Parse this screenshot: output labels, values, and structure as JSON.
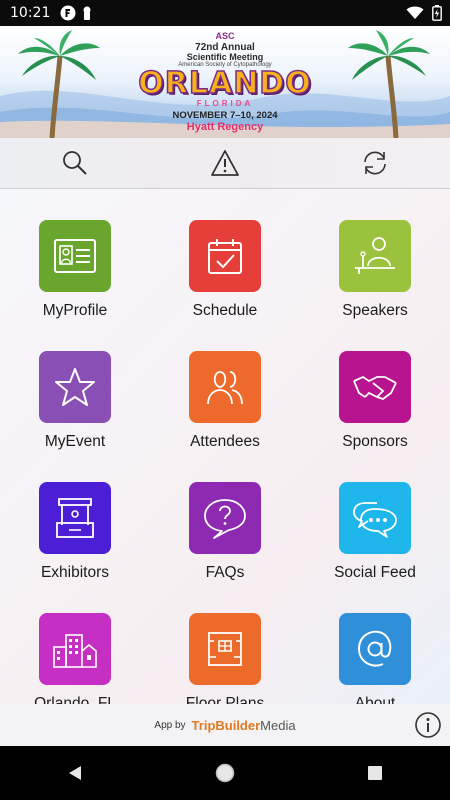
{
  "status_bar": {
    "time": "10:21"
  },
  "banner": {
    "org_mark": "ASC",
    "line1": "72nd Annual",
    "line2": "Scientific Meeting",
    "line3": "American Society of Cytopathology",
    "city": "ORLANDO",
    "state": "FLORIDA",
    "dates": "NOVEMBER 7–10, 2024",
    "venue": "Hyatt Regency"
  },
  "toolbar": {
    "search_icon": "search-icon",
    "alert_icon": "alert-triangle-icon",
    "sync_icon": "sync-icon"
  },
  "tiles": [
    {
      "label": "MyProfile",
      "icon": "id-card-icon",
      "color": "#6aa62e"
    },
    {
      "label": "Schedule",
      "icon": "calendar-check-icon",
      "color": "#e63f3a"
    },
    {
      "label": "Speakers",
      "icon": "speaker-podium-icon",
      "color": "#9bc23c"
    },
    {
      "label": "MyEvent",
      "icon": "star-icon",
      "color": "#8a4fb5"
    },
    {
      "label": "Attendees",
      "icon": "people-icon",
      "color": "#ee6a2c"
    },
    {
      "label": "Sponsors",
      "icon": "handshake-icon",
      "color": "#b8148f"
    },
    {
      "label": "Exhibitors",
      "icon": "booth-icon",
      "color": "#4c1fd6"
    },
    {
      "label": "FAQs",
      "icon": "question-bubble-icon",
      "color": "#8d2ab1"
    },
    {
      "label": "Social Feed",
      "icon": "chat-bubbles-icon",
      "color": "#1fb6ec"
    },
    {
      "label": "Orlando, FL",
      "icon": "city-buildings-icon",
      "color": "#c52fc3"
    },
    {
      "label": "Floor Plans",
      "icon": "floor-plan-icon",
      "color": "#ec6a2a"
    },
    {
      "label": "About",
      "icon": "at-sign-icon",
      "color": "#2f8fd8"
    }
  ],
  "footer": {
    "prefix": "App by",
    "brand_part1": "TripBuilder",
    "brand_part2": "Media",
    "info_icon": "info-icon"
  },
  "nav_bar": {
    "back": "back-icon",
    "home": "home-icon",
    "recents": "recents-icon"
  }
}
